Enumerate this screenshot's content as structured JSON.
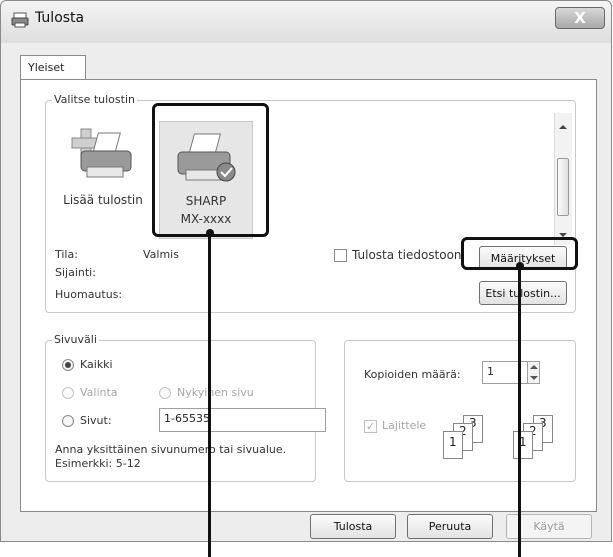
{
  "window": {
    "title": "Tulosta",
    "close": "X"
  },
  "tabs": [
    {
      "label": "Yleiset"
    }
  ],
  "printer_group": {
    "legend": "Valitse tulostin",
    "printers": [
      {
        "name": "Lisää tulostin"
      },
      {
        "name": "SHARP",
        "model": "MX-xxxx"
      }
    ],
    "status_label": "Tila:",
    "status_value": "Valmis",
    "location_label": "Sijainti:",
    "comment_label": "Huomautus:",
    "print_to_file": "Tulosta tiedostoon",
    "preferences_button": "Määritykset",
    "find_printer_button": "Etsi tulostin..."
  },
  "range_group": {
    "legend": "Sivuväli",
    "all": "Kaikki",
    "selection": "Valinta",
    "current_page": "Nykyinen sivu",
    "pages": "Sivut:",
    "pages_value": "1-65535",
    "hint": "Anna yksittäinen sivunumero tai sivualue.",
    "example": "Esimerkki: 5-12"
  },
  "copies": {
    "label": "Kopioiden määrä:",
    "value": "1",
    "collate": "Lajittele",
    "collate_digits": [
      "1",
      "2",
      "3"
    ]
  },
  "footer": {
    "print": "Tulosta",
    "cancel": "Peruuta",
    "apply": "Käytä"
  }
}
